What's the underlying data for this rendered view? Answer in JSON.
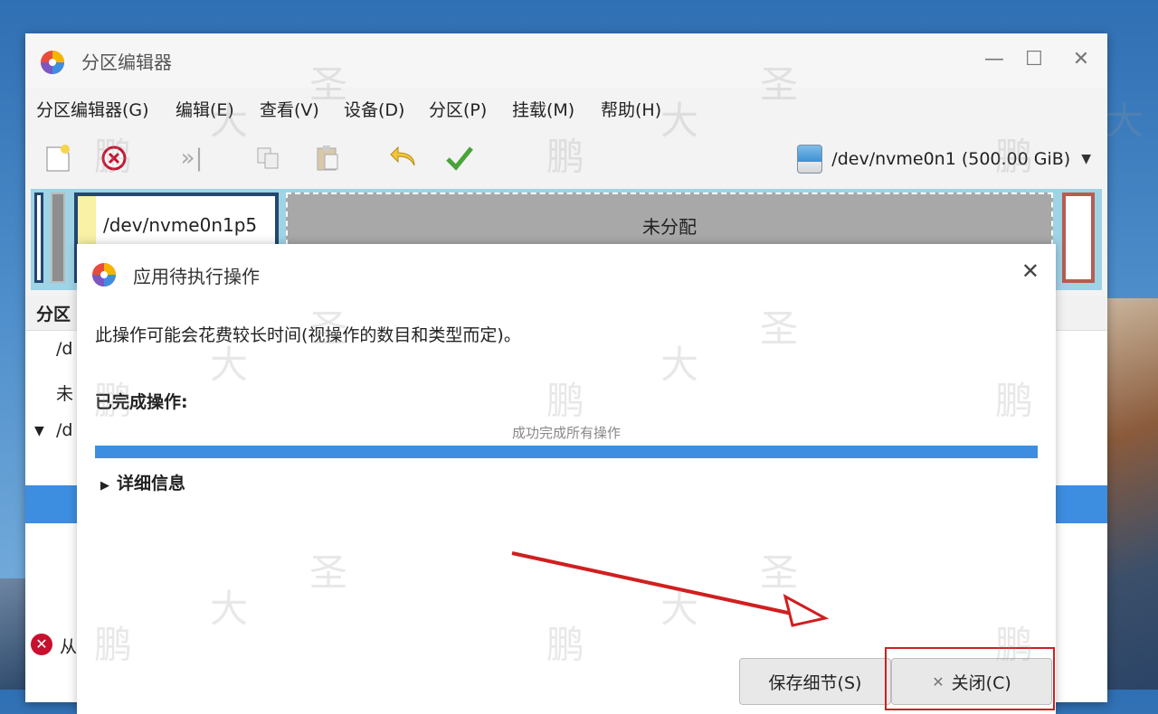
{
  "window": {
    "title": "分区编辑器",
    "controls": {
      "minimize": "—",
      "maximize": "☐",
      "close": "✕"
    }
  },
  "menubar": {
    "items": [
      "分区编辑器(G)",
      "编辑(E)",
      "查看(V)",
      "设备(D)",
      "分区(P)",
      "挂载(M)",
      "帮助(H)"
    ]
  },
  "toolbar": {
    "device_label": "/dev/nvme0n1 (500.00 GiB)",
    "icons": [
      "new-icon",
      "delete-icon",
      "resize-icon",
      "copy-icon",
      "paste-icon",
      "undo-icon",
      "apply-icon"
    ]
  },
  "diskmap": {
    "partition_label": "/dev/nvme0n1p5",
    "unallocated_label": "未分配"
  },
  "partition_list": {
    "header": "分区",
    "rows": [
      "/d",
      "未",
      "/d"
    ],
    "status_text": "从"
  },
  "dialog": {
    "title": "应用待执行操作",
    "close": "✕",
    "message": "此操作可能会花费较长时间(视操作的数目和类型而定)。",
    "completed_label": "已完成操作:",
    "progress_text": "成功完成所有操作",
    "progress_value": 1.0,
    "details_label": "详细信息",
    "save_details_button": "保存细节(S)",
    "close_button": "关闭(C)",
    "close_button_icon": "✕"
  },
  "watermark": [
    "鹏",
    "大",
    "圣"
  ],
  "colors": {
    "accent": "#3d8ee0",
    "highlight": "#d01f1f",
    "partition_border": "#24476e"
  }
}
